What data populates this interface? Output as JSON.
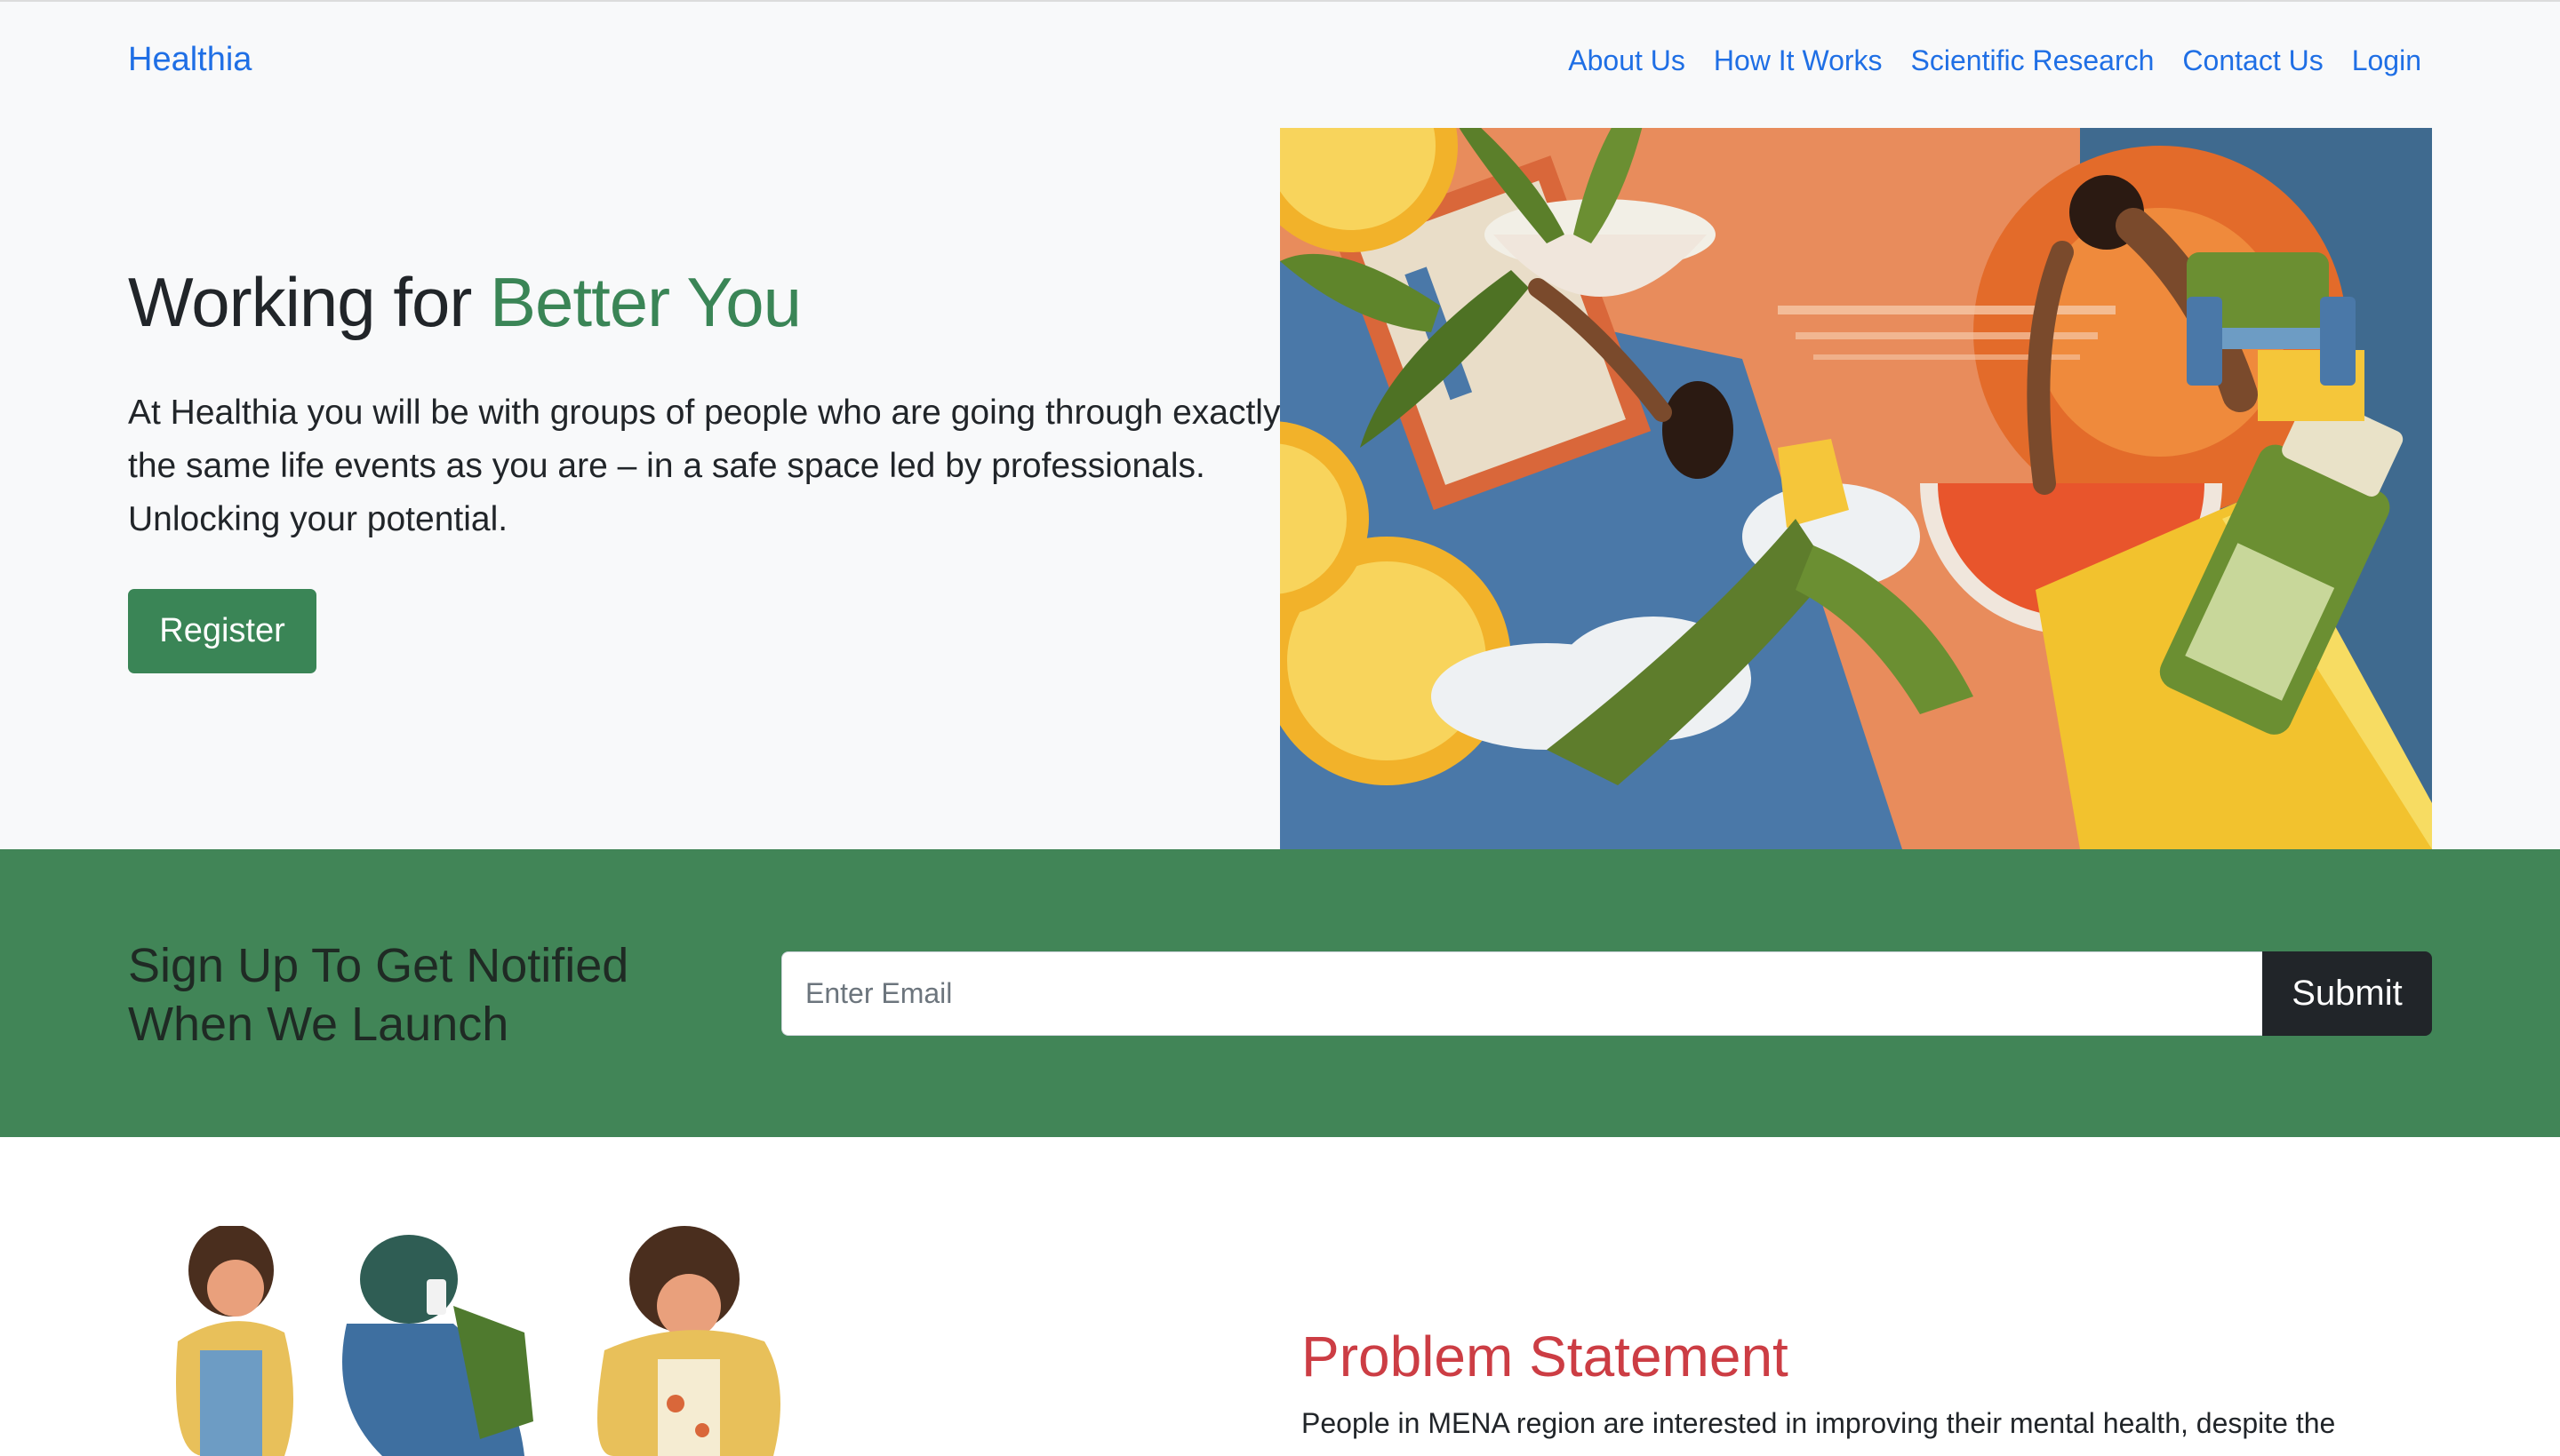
{
  "nav": {
    "brand": "Healthia",
    "links": [
      "About Us",
      "How It Works",
      "Scientific Research",
      "Contact Us",
      "Login"
    ]
  },
  "hero": {
    "title_main": "Working for ",
    "title_accent": "Better You",
    "lead": "At Healthia you will be with groups of people who are going through exactly the same life events as you are – in a safe space led by professionals. Unlocking your potential.",
    "register_label": "Register"
  },
  "signup": {
    "title": "Sign Up To Get Notified When We Launch",
    "email_placeholder": "Enter Email",
    "submit_label": "Submit"
  },
  "problem": {
    "title": "Problem Statement",
    "text": "People in MENA region are interested in improving their mental health, despite the"
  },
  "colors": {
    "accent_green": "#3a8556",
    "band_green": "#418557",
    "link_blue": "#1f6fe5",
    "problem_red": "#cc3d44",
    "dark": "#212529"
  }
}
